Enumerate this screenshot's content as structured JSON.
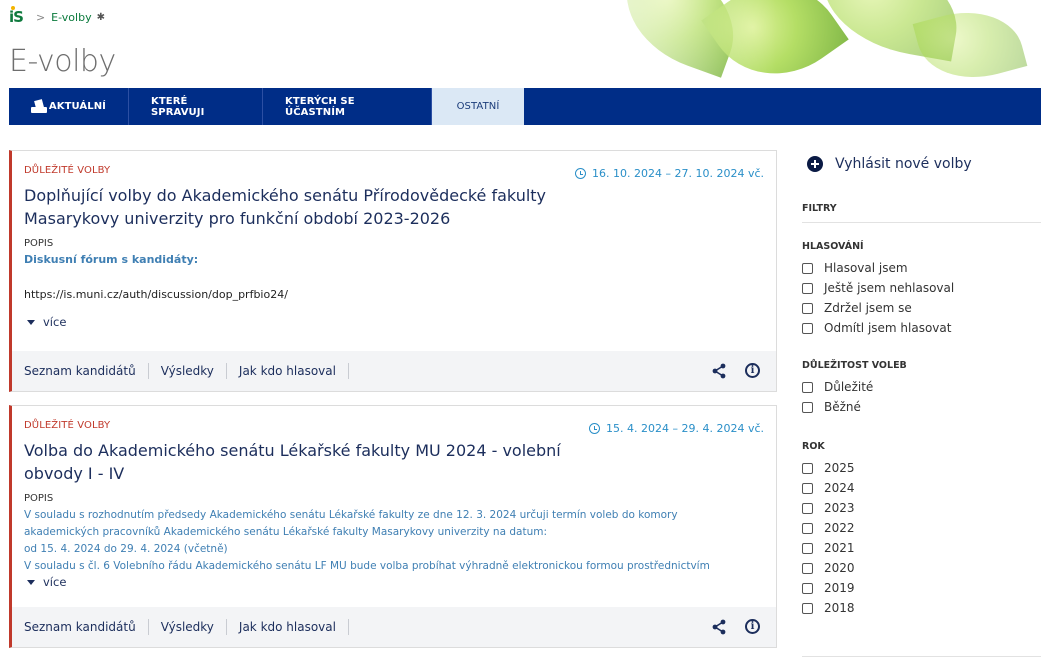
{
  "breadcrumb": {
    "logo": "iS",
    "separator": ">",
    "current": "E-volby",
    "pin_icon": "pin-icon"
  },
  "page": {
    "title": "E-volby"
  },
  "tabs": [
    {
      "label": "AKTUÁLNÍ",
      "icon": "ballot-box-icon"
    },
    {
      "label": "KTERÉ SPRAVUJI"
    },
    {
      "label": "KTERÝCH SE ÚČASTNÍM"
    },
    {
      "label": "OSTATNÍ",
      "active": true
    }
  ],
  "cards": [
    {
      "badge": "DŮLEŽITÉ VOLBY",
      "date": "16. 10. 2024 – 27. 10. 2024 vč.",
      "title": "Doplňující volby do Akademického senátu Přírodovědecké fakulty Masarykovy univerzity pro funkční období 2023-2026",
      "popis_label": "POPIS",
      "desc": "Diskusní fórum s kandidáty:",
      "url": "https://is.muni.cz/auth/discussion/dop_prfbio24/",
      "more": "více",
      "footer": [
        "Seznam kandidátů",
        "Výsledky",
        "Jak kdo hlasoval"
      ]
    },
    {
      "badge": "DŮLEŽITÉ VOLBY",
      "date": "15. 4. 2024 – 29. 4. 2024 vč.",
      "title": "Volba do Akademického senátu Lékařské fakulty MU 2024 - volební obvody I - IV",
      "popis_label": "POPIS",
      "desc_lines": [
        "V souladu s rozhodnutím předsedy Akademického senátu Lékařské fakulty ze dne 12. 3. 2024 určuji termín voleb do komory",
        "akademických pracovníků Akademického senátu Lékařské fakulty Masarykovy univerzity na datum:",
        "od 15. 4. 2024 do 29. 4. 2024 (včetně)",
        "V souladu s čl. 6 Volebního řádu Akademického senátu LF MU bude volba probíhat výhradně elektronickou formou prostřednictvím"
      ],
      "more": "více",
      "footer": [
        "Seznam kandidátů",
        "Výsledky",
        "Jak kdo hlasoval"
      ]
    }
  ],
  "sidebar": {
    "new_election": "Vyhlásit nové volby",
    "filters_label": "FILTRY",
    "groups": [
      {
        "heading": "HLASOVÁNÍ",
        "options": [
          "Hlasoval jsem",
          "Ještě jsem nehlasoval",
          "Zdržel jsem se",
          "Odmítl jsem hlasovat"
        ]
      },
      {
        "heading": "DŮLEŽITOST VOLEB",
        "options": [
          "Důležité",
          "Běžné"
        ]
      },
      {
        "heading": "ROK",
        "options": [
          "2025",
          "2024",
          "2023",
          "2022",
          "2021",
          "2020",
          "2019",
          "2018"
        ]
      }
    ]
  },
  "colors": {
    "nav_bg": "#002d87",
    "active_tab_bg": "#dbe8f5",
    "important_red": "#c0392b",
    "link_blue": "#2a8fc8",
    "title_navy": "#1c2e5c"
  }
}
